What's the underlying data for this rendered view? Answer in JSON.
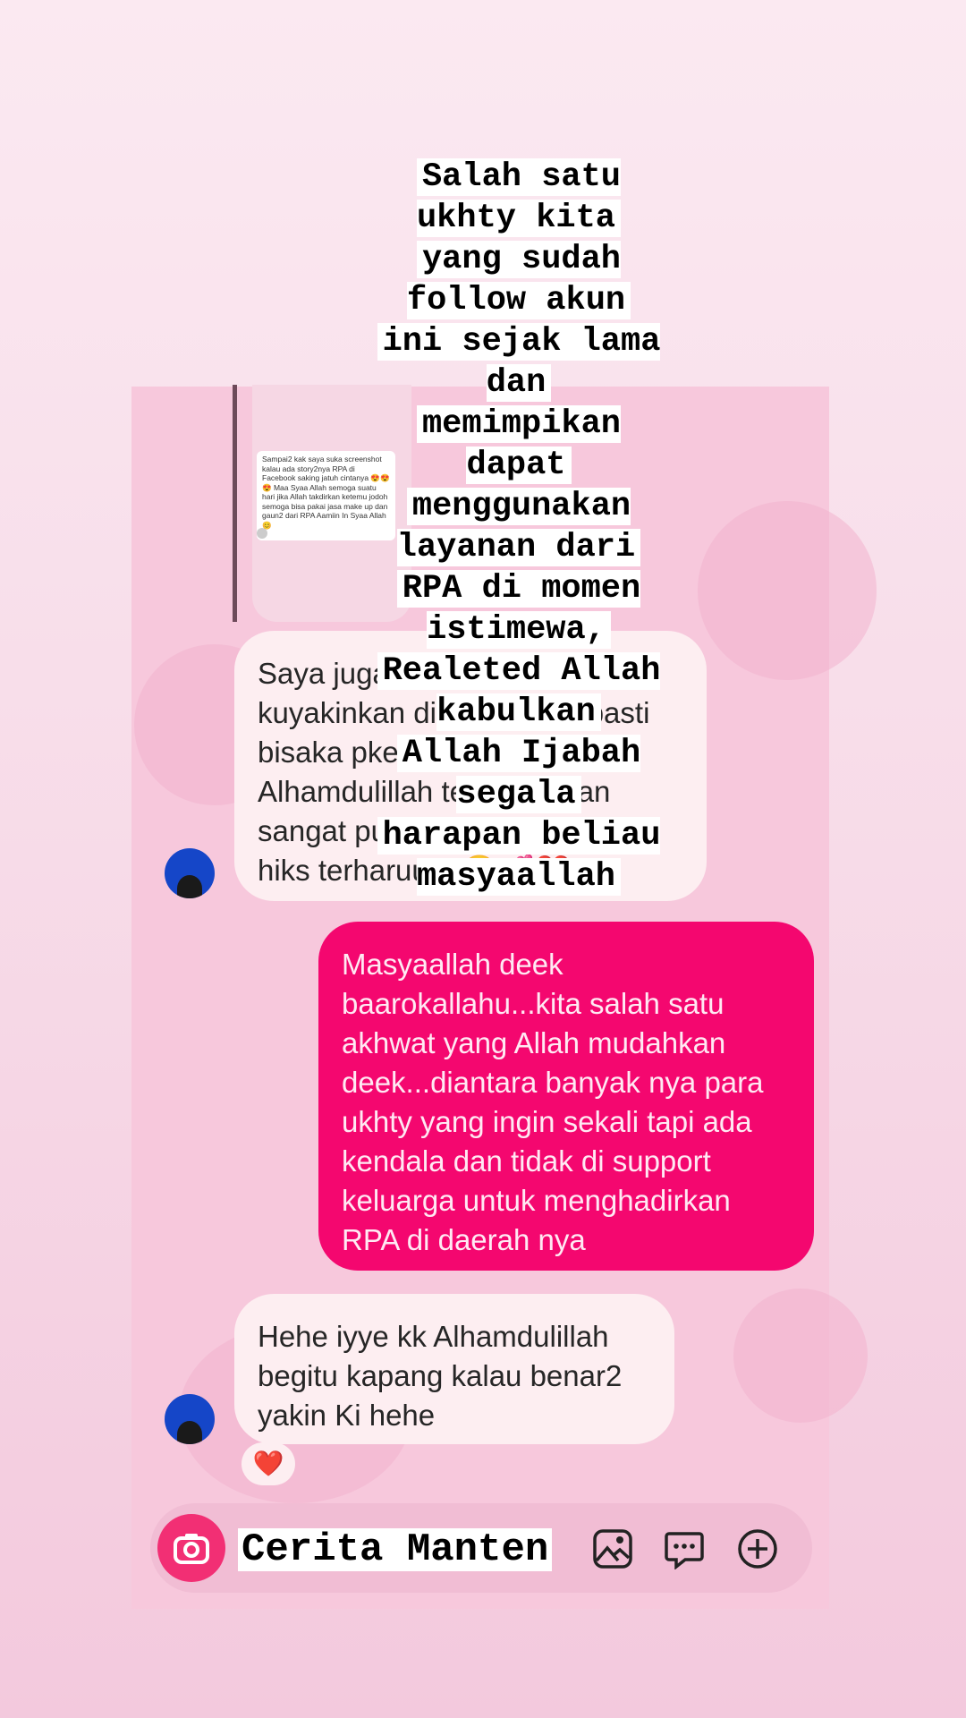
{
  "caption": {
    "lines": [
      "Salah satu ukhty kita",
      "yang sudah follow akun",
      "ini sejak lama dan",
      "memimpikan dapat",
      "menggunakan layanan dari",
      "RPA di momen istimewa,",
      "Realeted Allah kabulkan",
      "Allah Ijabah segala",
      "harapan beliau masyaallah"
    ]
  },
  "quoted_story": {
    "text": "Sampai2 kak saya suka screenshot kalau ada story2nya RPA di Facebook saking jatuh cintanya 😍😍😍 Maa Syaa Allah semoga suatu hari jika Allah takdirkan ketemu jodoh semoga bisa pakai jasa make up dan gaun2 dari RPA Aamiin In Syaa Allah 😊"
  },
  "messages": [
    {
      "side": "in",
      "lines": [
        "Saya juga dulu beginika, dan",
        "kuyakinkan diriku bahwa pasti",
        "bisaka pke jasa RPA daann",
        "Alhamdulillah terwujud dan",
        "sangat puas Maasyaa Allah",
        "hiks terharuuuu🥺💕❤️"
      ]
    },
    {
      "side": "out",
      "lines": [
        "Masyaallah deek",
        "baarokallahu...kita salah satu",
        "akhwat yang Allah mudahkan",
        "deek...diantara banyak nya para",
        "ukhty yang ingin sekali tapi ada",
        "kendala dan tidak di support",
        "keluarga untuk menghadirkan",
        "RPA di daerah nya"
      ]
    },
    {
      "side": "in",
      "lines": [
        "Hehe iyye kk Alhamdulillah",
        "begitu kapang kalau benar2",
        "yakin Ki hehe"
      ]
    }
  ],
  "reaction": "❤️",
  "composer": {
    "label": "Cerita Manten",
    "icons": [
      "camera-icon",
      "gallery-icon",
      "sticker-chat-icon",
      "add-circle-icon"
    ]
  },
  "colors": {
    "outgoing_bubble": "#f4076f",
    "incoming_bubble": "#fdeef1",
    "camera_button": "#f22f74",
    "avatar": "#1546c8"
  }
}
